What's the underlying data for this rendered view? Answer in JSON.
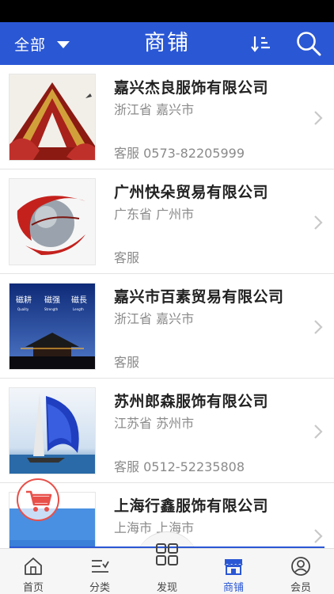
{
  "header": {
    "filter_label": "全部",
    "title": "商铺"
  },
  "shops": [
    {
      "name": "嘉兴杰良服饰有限公司",
      "location": "浙江省 嘉兴市",
      "phone": "客服 0573-82205999",
      "thumb": "red-gold-roof"
    },
    {
      "name": "广州快朵贸易有限公司",
      "location": "广东省 广州市",
      "phone": "客服",
      "thumb": "globe-red-ribbon"
    },
    {
      "name": "嘉兴市百素贸易有限公司",
      "location": "浙江省 嘉兴市",
      "phone": "客服",
      "thumb": "temple-night"
    },
    {
      "name": "苏州郎森服饰有限公司",
      "location": "江苏省 苏州市",
      "phone": "客服 0512-52235808",
      "thumb": "sailboat-sea"
    },
    {
      "name": "上海行鑫服饰有限公司",
      "location": "上海市 上海市",
      "phone": "",
      "thumb": "blue-sky"
    }
  ],
  "thumb_texts": {
    "temple": [
      "磁耕",
      "磁强",
      "磁長"
    ],
    "temple_sub": [
      "Quality",
      "Strength",
      "Length"
    ]
  },
  "tabs": [
    {
      "label": "首页",
      "icon": "home-icon"
    },
    {
      "label": "分类",
      "icon": "category-icon"
    },
    {
      "label": "发现",
      "icon": "grid-icon"
    },
    {
      "label": "商铺",
      "icon": "shop-icon",
      "active": true
    },
    {
      "label": "会员",
      "icon": "member-icon"
    }
  ],
  "colors": {
    "primary": "#2a57d4",
    "cart_float": "#e8504a",
    "text_secondary": "#8a8a8a"
  }
}
